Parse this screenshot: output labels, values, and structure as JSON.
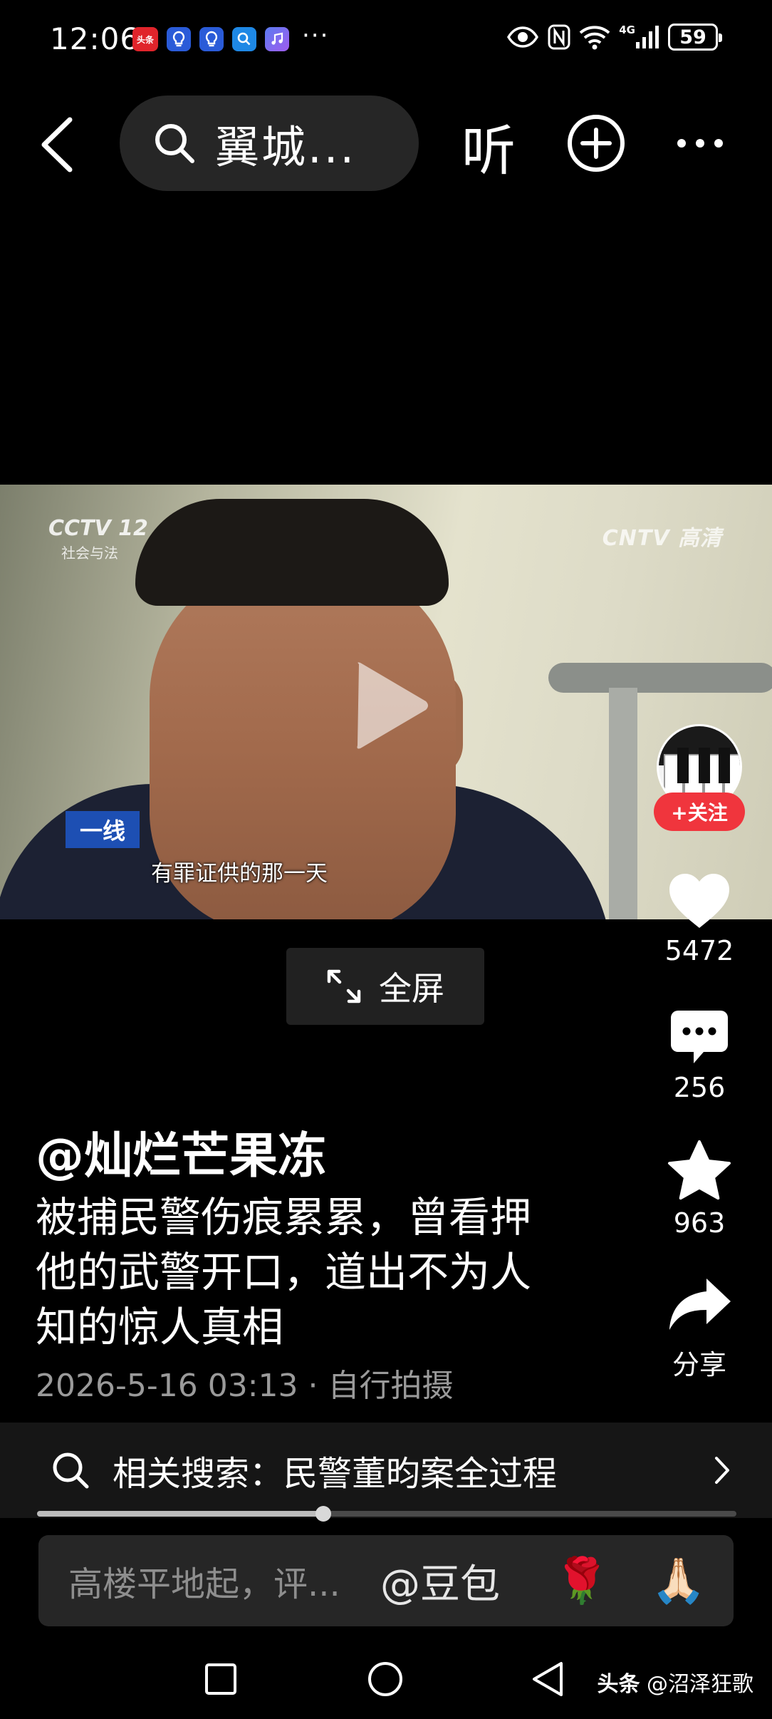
{
  "status_bar": {
    "time": "12:06",
    "notification_badge_1": "头条",
    "dots": "···",
    "network": "4G",
    "battery": "59"
  },
  "nav": {
    "search_text": "翼城...",
    "listen_label": "听"
  },
  "video": {
    "channel_logo": "CCTV 12",
    "channel_sub": "社会与法",
    "brand_logo": "CNTV 高清",
    "program_tag": "一线",
    "subtitle": "有罪证供的那一天"
  },
  "rail": {
    "follow_label": "+关注",
    "likes": "5472",
    "comments": "256",
    "favorites": "963",
    "share_label": "分享"
  },
  "fullscreen_label": "全屏",
  "post": {
    "author": "@灿烂芒果冻",
    "caption": "被捕民警伤痕累累，曾看押他的武警开口，道出不为人知的惊人真相",
    "meta": "2026-5-16 03:13 · 自行拍摄"
  },
  "related": {
    "text": "相关搜索：民警董昀案全过程"
  },
  "progress": 0.408,
  "comment_bar": {
    "placeholder": "高楼平地起，评...",
    "mention": "@豆包",
    "emoji_1": "🌹",
    "emoji_2": "🙏🏻"
  },
  "watermark": {
    "brand": "头条",
    "handle": "@沼泽狂歌"
  }
}
